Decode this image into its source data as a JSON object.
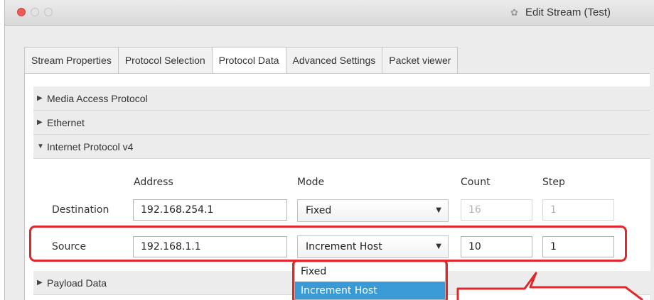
{
  "window": {
    "title": "Edit Stream (Test)"
  },
  "tabs": [
    {
      "label": "Stream Properties"
    },
    {
      "label": "Protocol Selection"
    },
    {
      "label": "Protocol Data"
    },
    {
      "label": "Advanced Settings"
    },
    {
      "label": "Packet viewer"
    }
  ],
  "active_tab": "Protocol Data",
  "sections": [
    {
      "label": "Media Access Protocol",
      "expanded": false
    },
    {
      "label": "Ethernet",
      "expanded": false
    },
    {
      "label": "Internet Protocol v4",
      "expanded": true
    },
    {
      "label": "Payload Data",
      "expanded": false
    }
  ],
  "columns": {
    "address": "Address",
    "mode": "Mode",
    "count": "Count",
    "step": "Step"
  },
  "rows": {
    "destination": {
      "label": "Destination",
      "address": "192.168.254.1",
      "mode": "Fixed",
      "count": "16",
      "step": "1"
    },
    "source": {
      "label": "Source",
      "address": "192.168.1.1",
      "mode": "Increment Host",
      "count": "10",
      "step": "1"
    }
  },
  "mode_options": [
    "Fixed",
    "Increment Host"
  ],
  "icons": {
    "collapsed": "triangle-right",
    "expanded": "triangle-down",
    "combo": "caret-down"
  },
  "colors": {
    "highlight": "#e3262a",
    "selection": "#3a9ad6"
  }
}
